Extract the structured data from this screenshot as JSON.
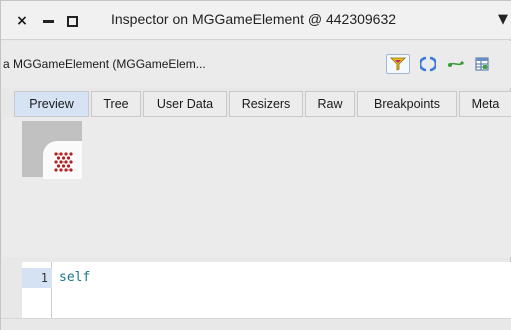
{
  "window": {
    "title": "Inspector on MGGameElement @ 442309632",
    "close_glyph": "×",
    "menu_glyph": "▼"
  },
  "object_bar": {
    "title": "a MGGameElement (MGGameElem...",
    "tools": [
      {
        "icon": "filter-icon",
        "active": true
      },
      {
        "icon": "refresh-icon",
        "active": false
      },
      {
        "icon": "browse-icon",
        "active": false
      },
      {
        "icon": "table-icon",
        "active": false
      }
    ]
  },
  "tabs": [
    {
      "label": "Preview",
      "selected": true
    },
    {
      "label": "Tree",
      "selected": false
    },
    {
      "label": "User Data",
      "selected": false
    },
    {
      "label": "Resizers",
      "selected": false
    },
    {
      "label": "Raw",
      "selected": false
    },
    {
      "label": "Breakpoints",
      "selected": false
    },
    {
      "label": "Meta",
      "selected": false
    }
  ],
  "editor": {
    "line_number": "1",
    "code": "self"
  },
  "colors": {
    "tab_selected": "#d6e3f5",
    "code_text": "#1a7a87",
    "preview_dots": "#b22222"
  }
}
